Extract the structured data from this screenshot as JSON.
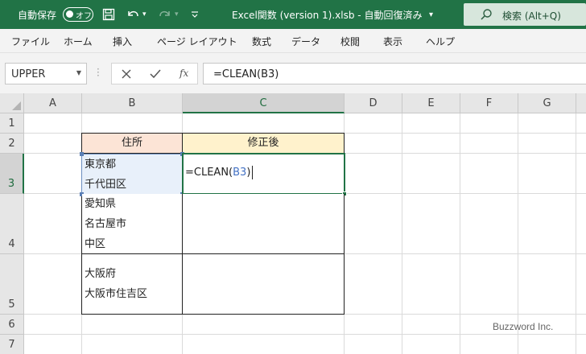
{
  "titlebar": {
    "autosave_label": "自動保存",
    "autosave_state": "オフ",
    "title": "Excel関数 (version 1).xlsb  -  自動回復済み",
    "search_placeholder": "検索 (Alt+Q)",
    "brand_color": "#217346"
  },
  "ribbon": {
    "tabs": [
      "ファイル",
      "ホーム",
      "挿入",
      "ページ レイアウト",
      "数式",
      "データ",
      "校閲",
      "表示",
      "ヘルプ"
    ]
  },
  "formula_bar": {
    "name_box": "UPPER",
    "cancel_icon": "close-icon",
    "enter_icon": "check-icon",
    "fx_label": "fx",
    "formula": "=CLEAN(B3)"
  },
  "grid": {
    "columns": [
      "A",
      "B",
      "C",
      "D",
      "E",
      "F",
      "G"
    ],
    "rows": [
      "1",
      "2",
      "3",
      "4",
      "5",
      "6",
      "7"
    ],
    "selected_column": "C",
    "selected_row": "3",
    "headers": {
      "b2": "住所",
      "c2": "修正後"
    },
    "b3": [
      "東京都",
      "千代田区"
    ],
    "b4": [
      "愛知県",
      "名古屋市",
      "中区"
    ],
    "b5": [
      "大阪府",
      "大阪市住吉区"
    ],
    "c3_formula_prefix": "=CLEAN(",
    "c3_formula_ref": "B3",
    "c3_formula_suffix": ")",
    "header_fill_b2": "#fce4d6",
    "header_fill_c2": "#fff2cc"
  },
  "watermark": "Buzzword Inc."
}
